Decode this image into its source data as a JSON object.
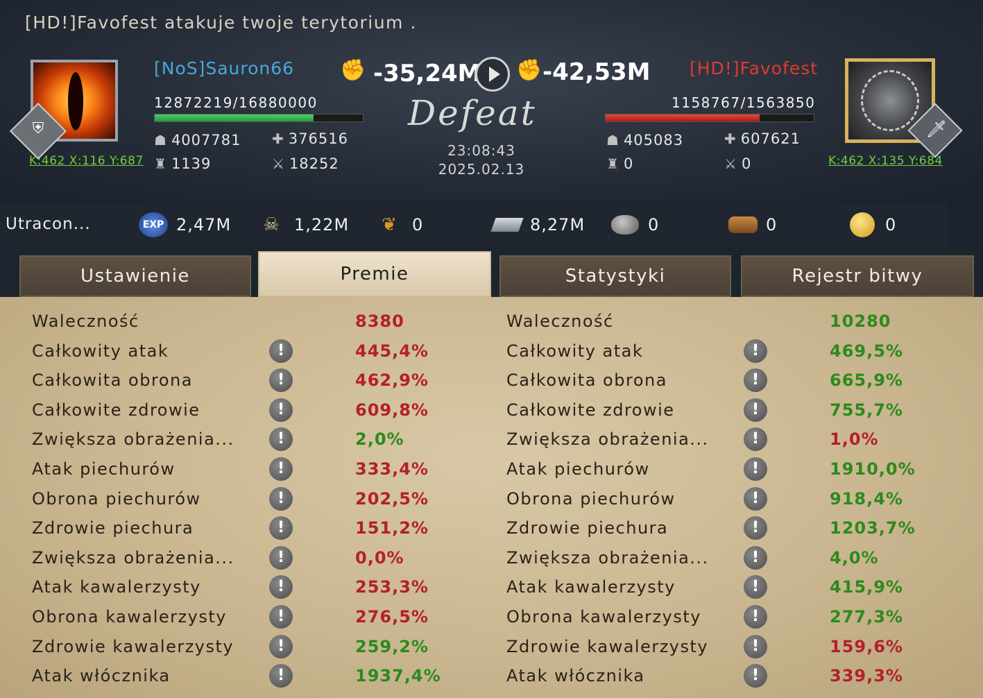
{
  "notice": "[HD!]Favofest atakuje twoje terytorium .",
  "left_player": {
    "name": "[NoS]Sauron66",
    "coords": "K:462 X:116 Y:687",
    "hp": "12872219/16880000",
    "hp_fraction": 0.762,
    "power_loss": "-35,24M",
    "stats": {
      "troops": "4007781",
      "attack": "376516",
      "tower": "1139",
      "wounded": "18252"
    }
  },
  "right_player": {
    "name": "[HD!]Favofest",
    "coords": "K:462 X:135 Y:684",
    "hp": "1158767/1563850",
    "hp_fraction": 0.741,
    "power_loss": "-42,53M",
    "stats": {
      "troops": "405083",
      "attack": "607621",
      "tower": "0",
      "wounded": "0"
    }
  },
  "result": "Defeat",
  "time": "23:08:43",
  "date": "2025.02.13",
  "losses": {
    "label": "Utracon...",
    "items": [
      {
        "icon": "exp-icon",
        "value": "2,47M"
      },
      {
        "icon": "kill-icon",
        "value": "1,22M"
      },
      {
        "icon": "food-icon",
        "value": "0"
      },
      {
        "icon": "iron-icon",
        "value": "8,27M"
      },
      {
        "icon": "stone-icon",
        "value": "0"
      },
      {
        "icon": "wood-icon",
        "value": "0"
      },
      {
        "icon": "gold-icon",
        "value": "0"
      }
    ]
  },
  "tabs": [
    {
      "label": "Ustawienie",
      "active": false
    },
    {
      "label": "Premie",
      "active": true
    },
    {
      "label": "Statystyki",
      "active": false
    },
    {
      "label": "Rejestr bitwy",
      "active": false
    }
  ],
  "info_glyph": "!",
  "bonuses_left": [
    {
      "name": "Waleczność",
      "value": "8380",
      "color": "red",
      "info": false
    },
    {
      "name": "Całkowity atak",
      "value": "445,4%",
      "color": "red",
      "info": true
    },
    {
      "name": "Całkowita obrona",
      "value": "462,9%",
      "color": "red",
      "info": true
    },
    {
      "name": "Całkowite zdrowie",
      "value": "609,8%",
      "color": "red",
      "info": true
    },
    {
      "name": "Zwiększa obrażenia...",
      "value": "2,0%",
      "color": "green",
      "info": true
    },
    {
      "name": "Atak piechurów",
      "value": "333,4%",
      "color": "red",
      "info": true
    },
    {
      "name": "Obrona piechurów",
      "value": "202,5%",
      "color": "red",
      "info": true
    },
    {
      "name": "Zdrowie piechura",
      "value": "151,2%",
      "color": "red",
      "info": true
    },
    {
      "name": "Zwiększa obrażenia...",
      "value": "0,0%",
      "color": "red",
      "info": true
    },
    {
      "name": "Atak kawalerzysty",
      "value": "253,3%",
      "color": "red",
      "info": true
    },
    {
      "name": "Obrona kawalerzysty",
      "value": "276,5%",
      "color": "red",
      "info": true
    },
    {
      "name": "Zdrowie kawalerzysty",
      "value": "259,2%",
      "color": "green",
      "info": true
    },
    {
      "name": "Atak włócznika",
      "value": "1937,4%",
      "color": "green",
      "info": true
    }
  ],
  "bonuses_right": [
    {
      "name": "Waleczność",
      "value": "10280",
      "color": "green",
      "info": false
    },
    {
      "name": "Całkowity atak",
      "value": "469,5%",
      "color": "green",
      "info": true
    },
    {
      "name": "Całkowita obrona",
      "value": "665,9%",
      "color": "green",
      "info": true
    },
    {
      "name": "Całkowite zdrowie",
      "value": "755,7%",
      "color": "green",
      "info": true
    },
    {
      "name": "Zwiększa obrażenia...",
      "value": "1,0%",
      "color": "red",
      "info": true
    },
    {
      "name": "Atak piechurów",
      "value": "1910,0%",
      "color": "green",
      "info": true
    },
    {
      "name": "Obrona piechurów",
      "value": "918,4%",
      "color": "green",
      "info": true
    },
    {
      "name": "Zdrowie piechura",
      "value": "1203,7%",
      "color": "green",
      "info": true
    },
    {
      "name": "Zwiększa obrażenia...",
      "value": "4,0%",
      "color": "green",
      "info": true
    },
    {
      "name": "Atak kawalerzysty",
      "value": "415,9%",
      "color": "green",
      "info": true
    },
    {
      "name": "Obrona kawalerzysty",
      "value": "277,3%",
      "color": "green",
      "info": true
    },
    {
      "name": "Zdrowie kawalerzysty",
      "value": "159,6%",
      "color": "red",
      "info": true
    },
    {
      "name": "Atak włócznika",
      "value": "339,3%",
      "color": "red",
      "info": true
    }
  ]
}
